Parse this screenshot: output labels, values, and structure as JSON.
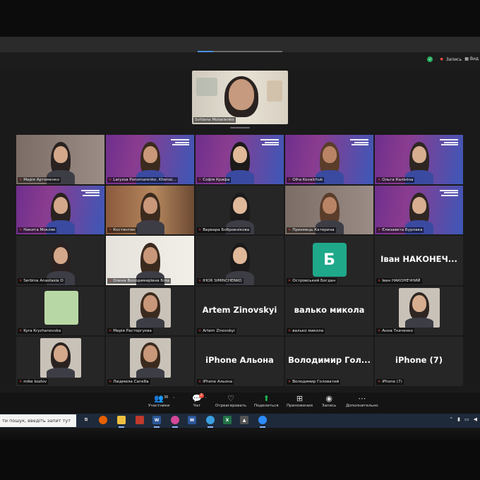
{
  "topbar": {
    "record_label": "Запись",
    "view_label": "Вид"
  },
  "spotlight": {
    "name": "Svitlana Moiseienko"
  },
  "participants": [
    {
      "name": "Марія Артеменко",
      "tile": "text_photo",
      "style": "room"
    },
    {
      "name": "Laryssa Ponomarenko, Kherso…",
      "tile": "brand_photo",
      "style": "brand"
    },
    {
      "name": "Софія Крифа",
      "tile": "brand_photo",
      "style": "brand"
    },
    {
      "name": "Olha Kovalchuk",
      "tile": "brand_photo",
      "style": "brand"
    },
    {
      "name": "Ольга Калініна",
      "tile": "brand_photo",
      "style": "brand"
    },
    {
      "name": "Никита Мокляк",
      "tile": "brand_photo",
      "style": "brand"
    },
    {
      "name": "Костянтин",
      "tile": "photo",
      "style": "warm"
    },
    {
      "name": "Варвара Бобровнікова",
      "tile": "photo",
      "style": "dark"
    },
    {
      "name": "Приємець Катерина",
      "tile": "photo",
      "style": "room"
    },
    {
      "name": "Єлизавета Бурлака",
      "tile": "brand_photo",
      "style": "brand"
    },
    {
      "name": "Serbina Anastasia O",
      "tile": "photo",
      "style": "dark"
    },
    {
      "name": "Олена Володимирівна Біла",
      "tile": "photo",
      "style": "light"
    },
    {
      "name": "IHOR SIMINCHENKO",
      "tile": "photo",
      "style": "dark"
    },
    {
      "name": "Островський Богдан",
      "tile": "avatar",
      "letter": "Б",
      "style": "dark"
    },
    {
      "name": "Іван НАКОНЕЧНИЙ",
      "display": "Іван  НАКОНЕЧ...",
      "tile": "name",
      "style": "dark"
    },
    {
      "name": "Kyra Kryzhanovska",
      "tile": "green",
      "style": "dark"
    },
    {
      "name": "Марія Расторгуєва",
      "tile": "photo_small",
      "style": "dark"
    },
    {
      "name": "Artem Zinovskyi",
      "display": "Artem Zinovskyi",
      "tile": "name",
      "style": "dark"
    },
    {
      "name": "валько микола",
      "display": "валько микола",
      "tile": "name",
      "style": "dark"
    },
    {
      "name": "Анна Ткаченко",
      "tile": "photo_small",
      "style": "dark"
    },
    {
      "name": "mike kozlov",
      "tile": "photo_small",
      "style": "dark"
    },
    {
      "name": "Людмила Сапєба",
      "tile": "photo_small",
      "style": "dark"
    },
    {
      "name": "iPhone Альона",
      "display": "iPhone Альона",
      "tile": "name",
      "style": "dark"
    },
    {
      "name": "Володимир Головатий",
      "display": "Володимир  Гол...",
      "tile": "name",
      "style": "dark"
    },
    {
      "name": "iPhone (7)",
      "display": "iPhone (7)",
      "tile": "name",
      "style": "dark"
    }
  ],
  "toolbar": {
    "participants_label": "Участники",
    "participants_count": "36",
    "chat_label": "Чат",
    "chat_badge": "2",
    "react_label": "Отреагировать",
    "share_label": "Поделиться",
    "apps_label": "Приложения",
    "record_label": "Запись",
    "more_label": "Дополнительно"
  },
  "taskbar": {
    "search_placeholder": "ти пошук, введіть запит тут"
  },
  "colors": {
    "brand_purple": "#6e2f8d",
    "brand_blue": "#3d58b8",
    "avatar_teal": "#1fa88a",
    "share_green": "#1db954",
    "mic_red": "#e74c3c"
  }
}
